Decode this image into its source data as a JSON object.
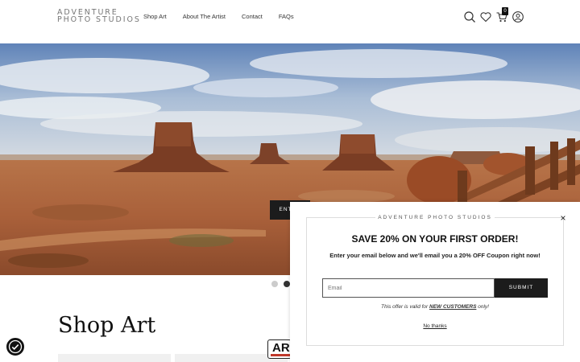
{
  "header": {
    "logo_line1": "ADVENTURE",
    "logo_line2": "PHOTO STUDIOS",
    "nav": [
      "Shop Art",
      "About The Artist",
      "Contact",
      "FAQs"
    ],
    "cart_count": "0",
    "icons": [
      "search-icon",
      "heart-icon",
      "cart-icon",
      "user-icon"
    ]
  },
  "hero": {
    "enter_label": "ENTER",
    "slides": 2,
    "active_slide": 2
  },
  "shop": {
    "title": "Shop Art",
    "ar_badge": "AR"
  },
  "popup": {
    "brand": "ADVENTURE PHOTO STUDIOS",
    "close": "×",
    "title": "SAVE 20% ON YOUR FIRST ORDER!",
    "description": "Enter your email below and we'll email you a 20% OFF Coupon right now!",
    "email_placeholder": "Email",
    "submit_label": "SUBMIT",
    "note_prefix": "This offer is valid for ",
    "note_highlight": "NEW CUSTOMERS",
    "note_suffix": " only!",
    "no_thanks": "No thanks"
  },
  "colors": {
    "accent": "#1c1c1c",
    "sky": "#7d9cc4",
    "desert": "#b5693a"
  }
}
